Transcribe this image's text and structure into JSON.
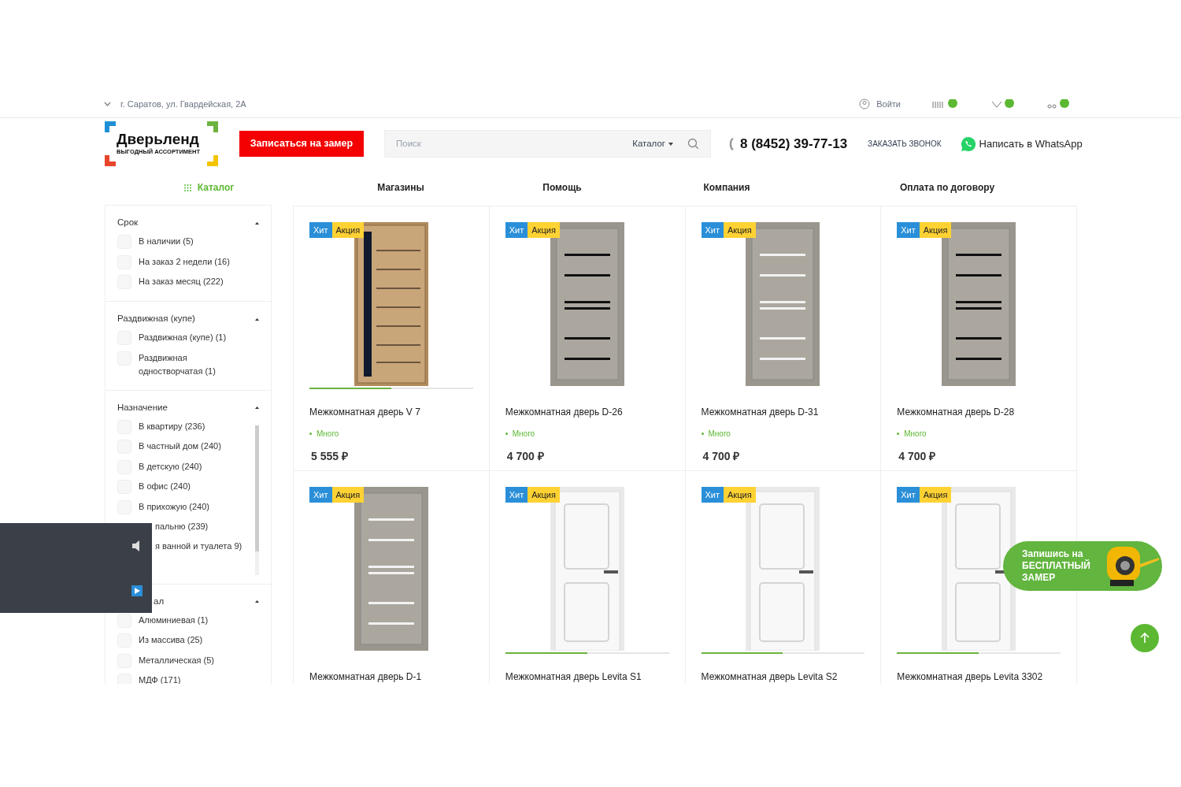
{
  "topbar": {
    "address": "г. Саратов, ул. Гвардейская, 2А",
    "login": "Войти"
  },
  "header": {
    "logo_title": "Дверьленд",
    "logo_subtitle": "ВЫГОДНЫЙ АССОРТИМЕНТ",
    "measure_button": "Записаться на замер",
    "search": {
      "placeholder": "Поиск",
      "scope": "Каталог"
    },
    "phone": "8 (8452) 39-77-13",
    "callback": "ЗАКАЗАТЬ ЗВОНОК",
    "whatsapp": "Написать в WhatsApp"
  },
  "nav": [
    {
      "label": "Каталог",
      "selected": true
    },
    {
      "label": "Магазины",
      "selected": false
    },
    {
      "label": "Помощь",
      "selected": false
    },
    {
      "label": "Компания",
      "selected": false
    },
    {
      "label": "Оплата по договору",
      "selected": false
    }
  ],
  "filters": [
    {
      "title": "Срок",
      "covered": false,
      "scroll": false,
      "options": [
        {
          "label": "В наличии (5)",
          "covered": false
        },
        {
          "label": "На заказ 2 недели (16)",
          "covered": false
        },
        {
          "label": "На заказ месяц (222)",
          "covered": false
        }
      ]
    },
    {
      "title": "Раздвижная (купе)",
      "covered": false,
      "scroll": false,
      "options": [
        {
          "label": "Раздвижная (купе) (1)",
          "covered": false
        },
        {
          "label": "Раздвижная одностворчатая (1)",
          "covered": false
        }
      ]
    },
    {
      "title": "Назначение",
      "covered": false,
      "scroll": true,
      "options": [
        {
          "label": "В квартиру (236)",
          "covered": false
        },
        {
          "label": "В частный дом (240)",
          "covered": false
        },
        {
          "label": "В детскую (240)",
          "covered": false
        },
        {
          "label": "В офис (240)",
          "covered": false
        },
        {
          "label": "В прихожую (240)",
          "covered": false
        },
        {
          "label": "пальню (239)",
          "covered": true
        },
        {
          "label": "я ванной и туалета 9)",
          "covered": true
        }
      ]
    },
    {
      "title": "ал",
      "covered": true,
      "scroll": false,
      "options": [
        {
          "label": "Алюминиевая (1)",
          "covered": false
        },
        {
          "label": "Из массива (25)",
          "covered": false
        },
        {
          "label": "Металлическая (5)",
          "covered": false
        },
        {
          "label": "МДФ (171)",
          "covered": false
        }
      ]
    }
  ],
  "products": [
    {
      "name": "Межкомнатная дверь V 7",
      "badges": [
        "Хит",
        "Акция"
      ],
      "kind": "oak",
      "image_bar": true,
      "stock": "Много",
      "price": "5 555 ₽"
    },
    {
      "name": "Межкомнатная дверь D-26",
      "badges": [
        "Хит",
        "Акция"
      ],
      "kind": "grey-dark",
      "image_bar": false,
      "stock": "Много",
      "price": "4 700 ₽"
    },
    {
      "name": "Межкомнатная дверь D-31",
      "badges": [
        "Хит",
        "Акция"
      ],
      "kind": "grey-light",
      "image_bar": false,
      "stock": "Много",
      "price": "4 700 ₽"
    },
    {
      "name": "Межкомнатная дверь D-28",
      "badges": [
        "Хит",
        "Акция"
      ],
      "kind": "grey-dark",
      "image_bar": false,
      "stock": "Много",
      "price": "4 700 ₽"
    },
    {
      "name": "Межкомнатная дверь D-1",
      "badges": [
        "Хит",
        "Акция"
      ],
      "kind": "grey-light",
      "image_bar": false
    },
    {
      "name": "Межкомнатная дверь Levita S1",
      "badges": [
        "Хит",
        "Акция"
      ],
      "kind": "white",
      "image_bar": true
    },
    {
      "name": "Межкомнатная дверь Levita S2",
      "badges": [
        "Хит",
        "Акция"
      ],
      "kind": "white",
      "image_bar": true
    },
    {
      "name": "Межкомнатная дверь Levita 3302",
      "badges": [
        "Хит",
        "Акция"
      ],
      "kind": "white",
      "image_bar": true
    }
  ],
  "promo": "Запишись на БЕСПЛАТНЫЙ ЗАМЕР"
}
